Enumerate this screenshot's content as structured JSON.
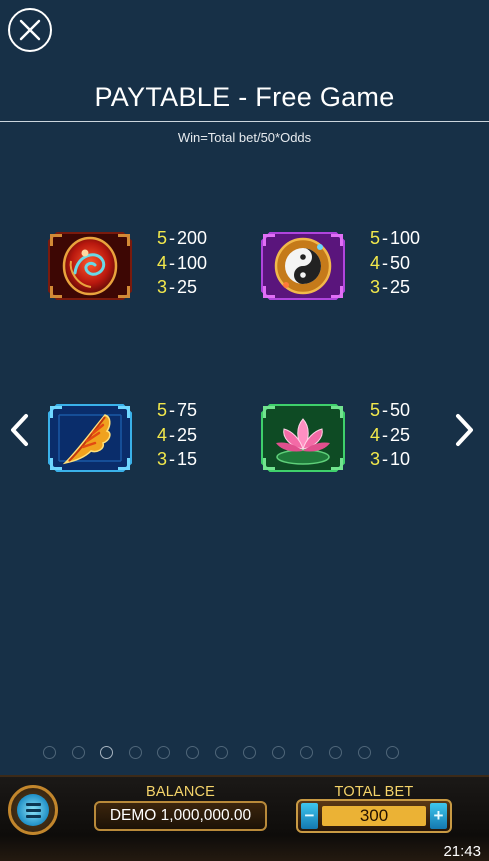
{
  "header": {
    "title": "PAYTABLE - Free Game",
    "subtitle": "Win=Total bet/50*Odds"
  },
  "symbols": [
    {
      "icon": "red-dragon-gem-icon",
      "odds": [
        {
          "count": "5",
          "value": "200"
        },
        {
          "count": "4",
          "value": "100"
        },
        {
          "count": "3",
          "value": "25"
        }
      ]
    },
    {
      "icon": "yin-yang-icon",
      "odds": [
        {
          "count": "5",
          "value": "100"
        },
        {
          "count": "4",
          "value": "50"
        },
        {
          "count": "3",
          "value": "25"
        }
      ]
    },
    {
      "icon": "phoenix-feather-icon",
      "odds": [
        {
          "count": "5",
          "value": "75"
        },
        {
          "count": "4",
          "value": "25"
        },
        {
          "count": "3",
          "value": "15"
        }
      ]
    },
    {
      "icon": "lotus-icon",
      "odds": [
        {
          "count": "5",
          "value": "50"
        },
        {
          "count": "4",
          "value": "25"
        },
        {
          "count": "3",
          "value": "10"
        }
      ]
    }
  ],
  "pagination": {
    "total": 13,
    "current_index": 2
  },
  "footer": {
    "balance_label": "BALANCE",
    "balance_value": "DEMO 1,000,000.00",
    "total_bet_label": "TOTAL BET",
    "total_bet_value": "300",
    "minus": "−",
    "plus": "+"
  },
  "status": {
    "time": "21:43"
  },
  "colors": {
    "background": "#173047",
    "odds_count": "#f2e84c",
    "accent_gold": "#ebb235"
  }
}
